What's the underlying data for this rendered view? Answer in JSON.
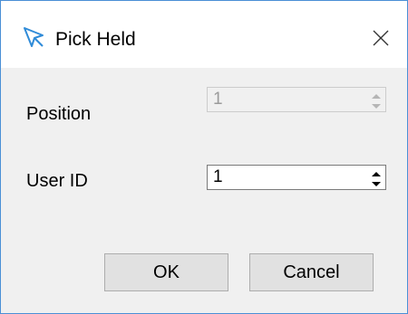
{
  "window": {
    "title": "Pick Held",
    "accent_color": "#4a8fd6"
  },
  "form": {
    "position": {
      "label": "Position",
      "value": "1",
      "enabled": false
    },
    "user_id": {
      "label": "User ID",
      "value": "1",
      "enabled": true
    }
  },
  "buttons": {
    "ok_label": "OK",
    "cancel_label": "Cancel"
  },
  "icons": {
    "title": "cursor-arrow-icon",
    "close": "close-icon",
    "spin_up": "chevron-up-icon",
    "spin_down": "chevron-down-icon"
  }
}
